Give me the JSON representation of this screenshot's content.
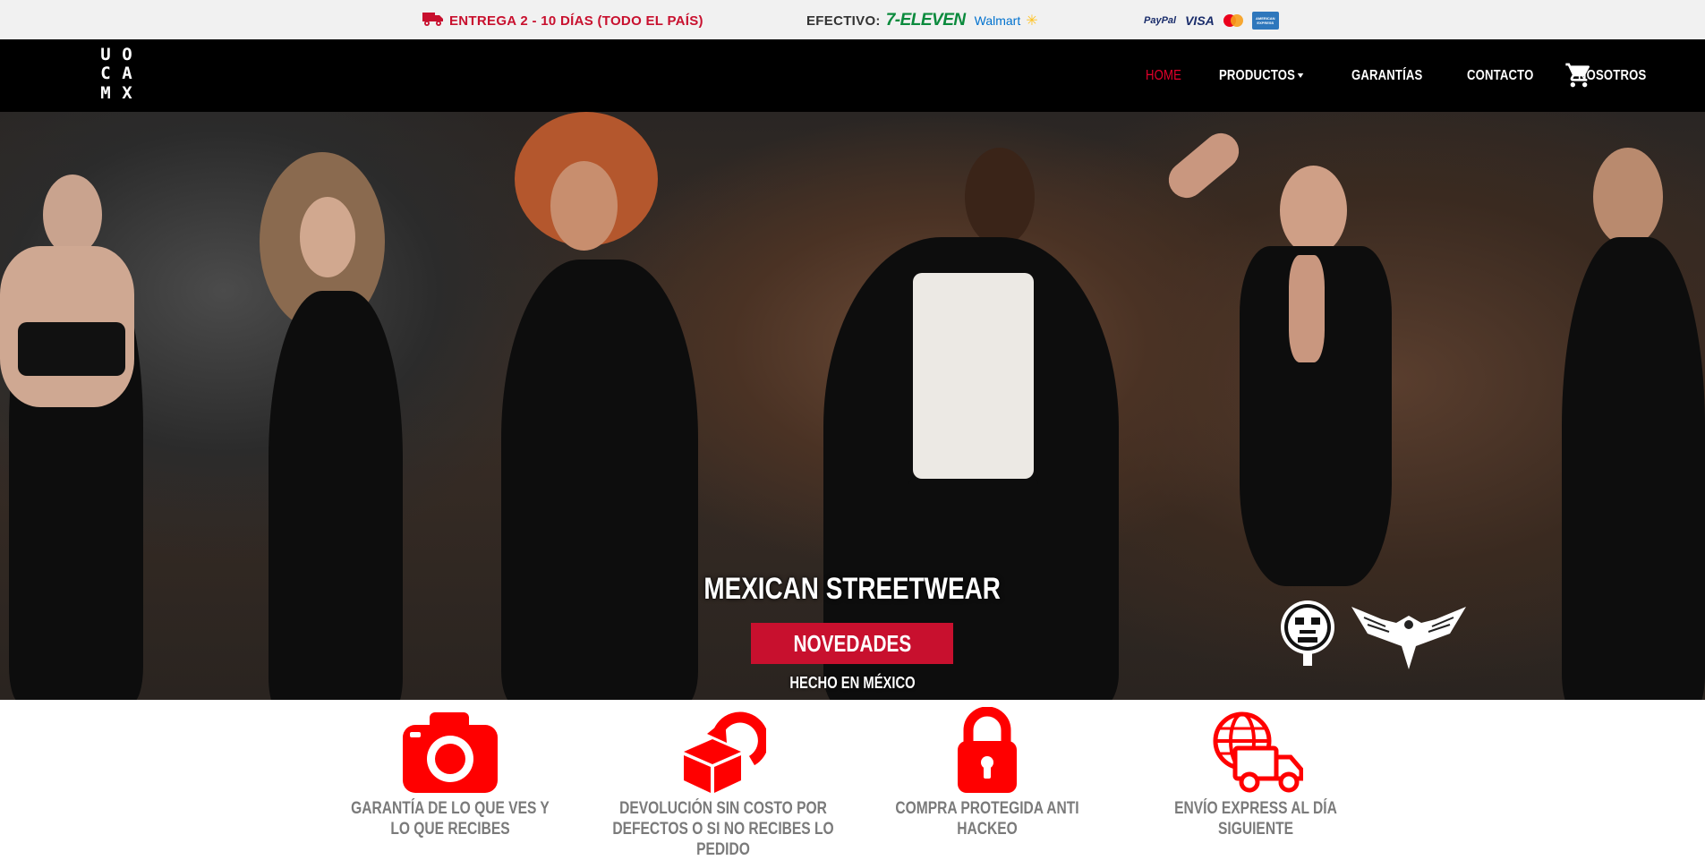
{
  "topbar": {
    "delivery_text": "ENTREGA 2 - 10 DÍAS (TODO EL PAÍS)",
    "delivery_icon": "truck-icon",
    "cash_label": "EFECTIVO:",
    "seven_eleven": "7-ELEVEN",
    "walmart": "Walmart",
    "payment_cards": [
      "PayPal",
      "VISA",
      "Mastercard",
      "American Express"
    ],
    "paypal": "PayPal",
    "visa": "VISA",
    "amex": "AMERICAN EXPRESS"
  },
  "nav": {
    "logo_letters": [
      "U",
      "O",
      "C",
      "A",
      "M",
      "X"
    ],
    "links": [
      {
        "label": "HOME",
        "active": true
      },
      {
        "label": "PRODUCTOS",
        "dropdown": true
      },
      {
        "label": "GARANTÍAS"
      },
      {
        "label": "CONTACTO"
      },
      {
        "label": "NOSOTROS"
      }
    ],
    "cart_icon": "cart-icon"
  },
  "hero": {
    "title": "MEXICAN STREETWEAR",
    "button": "NOVEDADES",
    "subtitle": "HECHO EN MÉXICO"
  },
  "features": [
    {
      "icon": "camera-icon",
      "label": "GARANTÍA DE LO QUE VES Y LO QUE RECIBES"
    },
    {
      "icon": "return-box-icon",
      "label": "DEVOLUCIÓN SIN COSTO POR DEFECTOS O SI NO RECIBES LO PEDIDO"
    },
    {
      "icon": "lock-icon",
      "label": "COMPRA PROTEGIDA ANTI HACKEO"
    },
    {
      "icon": "express-truck-icon",
      "label": "ENVÍO EXPRESS AL DÍA SIGUIENTE"
    }
  ],
  "colors": {
    "accent": "#c8102e",
    "nav_bg": "#000000",
    "topbar_bg": "#f1f1f1",
    "feature_icon": "#ff0000",
    "feature_text": "#7a7a7a"
  }
}
